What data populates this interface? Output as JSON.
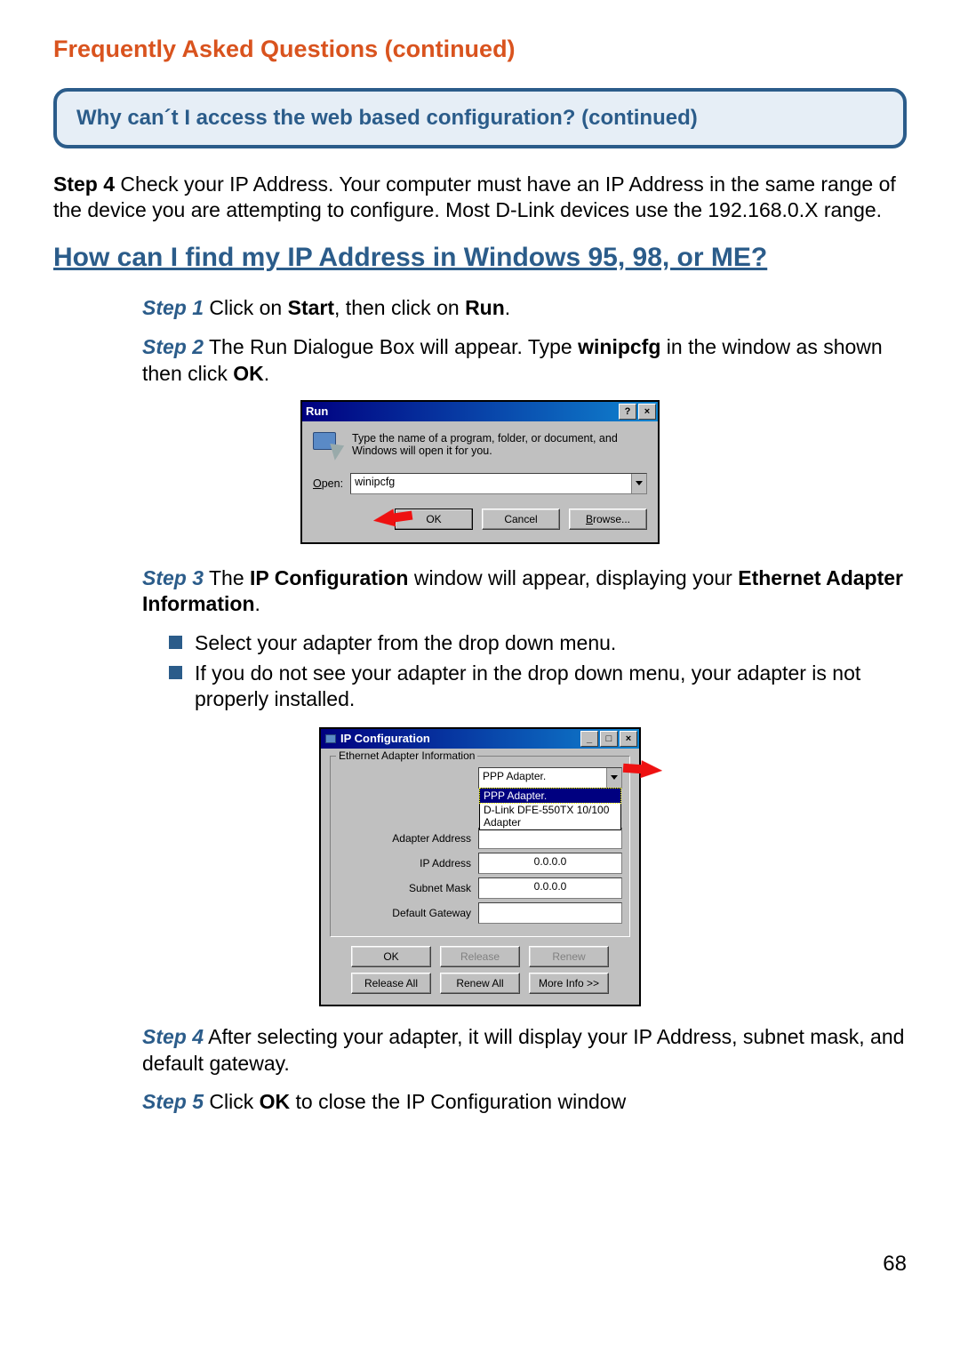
{
  "page": {
    "title": "Frequently Asked Questions (continued)",
    "question_box": "Why can´t I access the web based configuration? (continued)",
    "page_number": "68"
  },
  "intro": {
    "step4_label": "Step 4",
    "step4_text": " Check your IP Address. Your computer must have an IP Address in the same range of the device you are attempting to configure. Most D-Link devices use the 192.168.0.X range."
  },
  "section_heading": "How can I find my IP Address in Windows 95, 98, or ME?",
  "steps": {
    "s1_label": "Step 1",
    "s1_a": " Click on ",
    "s1_b1": "Start",
    "s1_c": ", then click on ",
    "s1_b2": "Run",
    "s1_d": ".",
    "s2_label": "Step 2",
    "s2_a": " The Run Dialogue Box will appear. Type ",
    "s2_b1": "winipcfg",
    "s2_c": " in the window as shown then click ",
    "s2_b2": "OK",
    "s2_d": ".",
    "s3_label": "Step 3",
    "s3_a": " The ",
    "s3_b1": "IP Configuration",
    "s3_c": " window will appear, displaying your ",
    "s3_b2": "Ethernet Adapter Information",
    "s3_d": ".",
    "bullet1": "Select your adapter from the drop down menu.",
    "bullet2": "If you do not see your adapter in the drop down menu, your adapter is not properly installed.",
    "s4_label": "Step 4",
    "s4_text": "  After selecting your adapter, it will display your IP Address, subnet mask, and default gateway.",
    "s5_label": "Step 5",
    "s5_a": "  Click ",
    "s5_b1": "OK",
    "s5_c": " to close the IP Configuration window"
  },
  "run_dialog": {
    "title": "Run",
    "instruction": "Type the name of a program, folder, or document, and Windows will open it for you.",
    "open_label_pre": "O",
    "open_label_rest": "pen:",
    "input_value": "winipcfg",
    "ok": "OK",
    "cancel": "Cancel",
    "browse_pre": "B",
    "browse_rest": "rowse..."
  },
  "ipcfg": {
    "title": "IP Configuration",
    "group": "Ethernet  Adapter Information",
    "adapter_selected": "PPP Adapter.",
    "dropdown": {
      "opt1": "PPP Adapter.",
      "opt2": "D-Link DFE-550TX 10/100 Adapter"
    },
    "labels": {
      "adapter_address": "Adapter Address",
      "ip_address": "IP Address",
      "subnet": "Subnet Mask",
      "gateway": "Default Gateway"
    },
    "values": {
      "adapter_address": "",
      "ip": "0.0.0.0",
      "subnet": "0.0.0.0",
      "gateway": ""
    },
    "buttons": {
      "ok": "OK",
      "release": "Release",
      "renew": "Renew",
      "release_all": "Release All",
      "renew_all": "Renew All",
      "more_info": "More Info >>"
    }
  }
}
